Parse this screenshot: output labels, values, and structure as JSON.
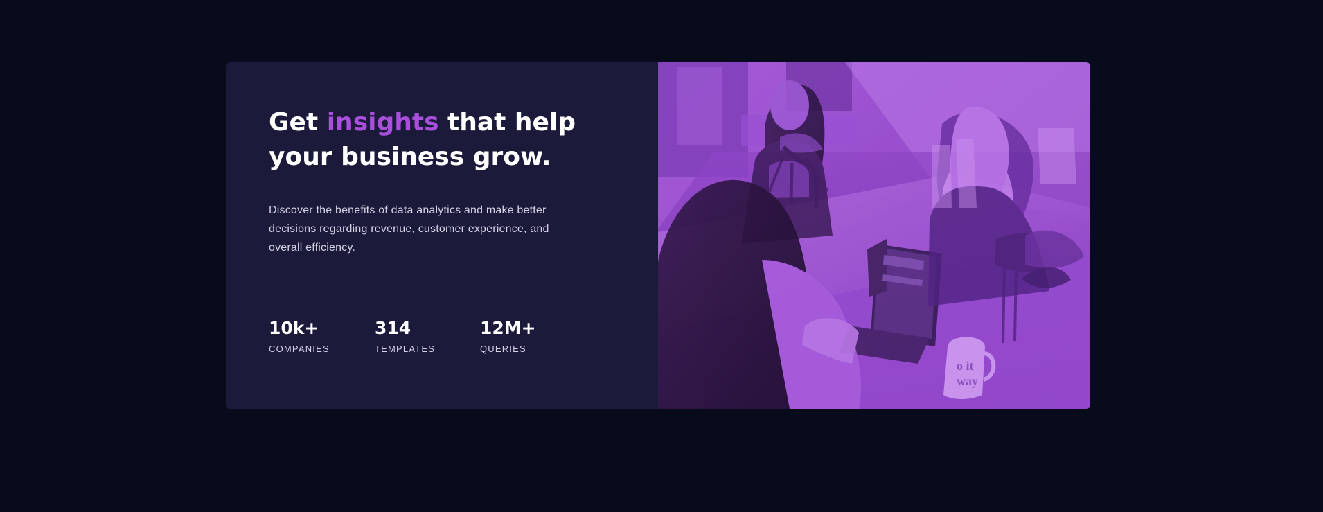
{
  "card": {
    "heading": {
      "before": "Get ",
      "accent": "insights",
      "after": " that help your business grow."
    },
    "description": "Discover the benefits of data analytics and make better decisions regarding revenue, customer experience, and overall efficiency.",
    "stats": [
      {
        "value": "10k+",
        "label": "COMPANIES"
      },
      {
        "value": "314",
        "label": "TEMPLATES"
      },
      {
        "value": "12M+",
        "label": "QUERIES"
      }
    ]
  },
  "image": {
    "name": "office-workers-photo",
    "mug_text_1": "o it",
    "mug_text_2": "way"
  },
  "colors": {
    "page_background": "#080b1c",
    "card_background": "#1b1a3b",
    "accent": "#a94fdc",
    "text": "#ffffff",
    "muted_text": "#d3d1e6",
    "image_tint": "#aa5cdb"
  }
}
